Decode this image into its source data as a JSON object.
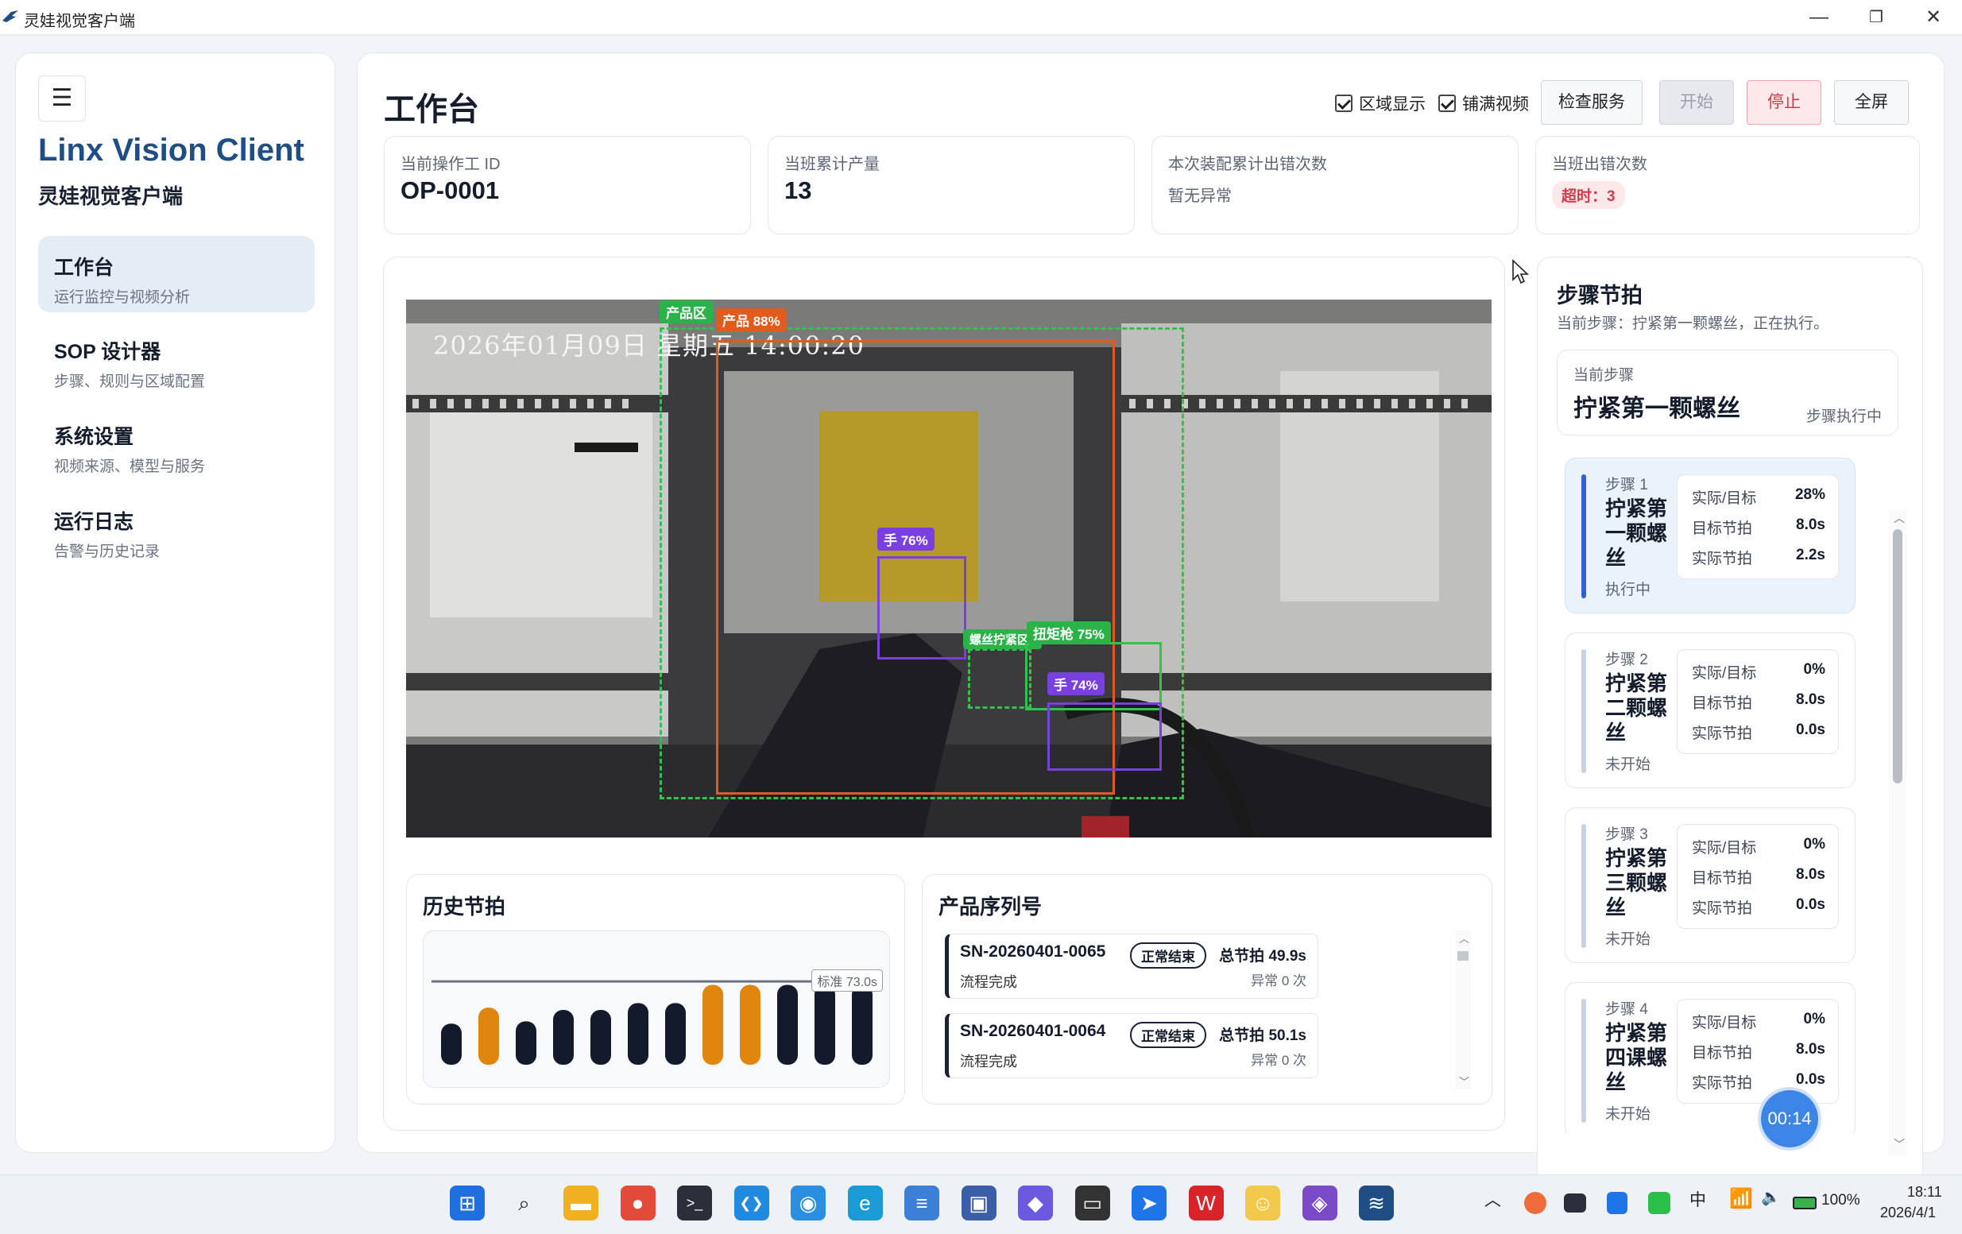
{
  "window": {
    "title": "灵娃视觉客户端",
    "minimize": "—",
    "restore": "❐",
    "close": "✕"
  },
  "sidebar": {
    "menu_icon": "☰",
    "brand": "Linx Vision Client",
    "brand_sub": "灵娃视觉客户端",
    "items": [
      {
        "title": "工作台",
        "desc": "运行监控与视频分析",
        "active": true
      },
      {
        "title": "SOP 设计器",
        "desc": "步骤、规则与区域配置"
      },
      {
        "title": "系统设置",
        "desc": "视频来源、模型与服务"
      },
      {
        "title": "运行日志",
        "desc": "告警与历史记录"
      }
    ]
  },
  "header": {
    "title": "工作台",
    "checkbox_region": "区域显示",
    "checkbox_fill": "铺满视频",
    "btn_check": "检查服务",
    "btn_start": "开始",
    "btn_stop": "停止",
    "btn_full": "全屏"
  },
  "stats": {
    "operator_label": "当前操作工 ID",
    "operator_value": "OP-0001",
    "output_label": "当班累计产量",
    "output_value": "13",
    "errors_label": "本次装配累计出错次数",
    "errors_value": "暂无异常",
    "shift_errors_label": "当班出错次数",
    "shift_errors_badge": "超时：3"
  },
  "video": {
    "osd_time": "2026年01月09日  星期五  14:00:20",
    "detections": [
      {
        "label": "产品区",
        "color": "#2bb34a"
      },
      {
        "label": "产品 88%",
        "color": "#e25a1c"
      },
      {
        "label": "手 76%",
        "color": "#7a3fe0"
      },
      {
        "label": "螺丝拧紧区1",
        "color": "#2bb34a"
      },
      {
        "label": "扭矩枪 75%",
        "color": "#2bb34a"
      },
      {
        "label": "手 74%",
        "color": "#7a3fe0"
      }
    ]
  },
  "history": {
    "title": "历史节拍",
    "standard_label": "标准 73.0s",
    "bar_colors": {
      "normal": "#121a2c",
      "over": "#e0860f"
    }
  },
  "chart_data": {
    "type": "bar",
    "title": "历史节拍",
    "values": [
      36,
      50,
      38,
      48,
      48,
      54,
      54,
      70,
      70,
      70,
      70,
      70
    ],
    "over_standard": [
      false,
      true,
      false,
      false,
      false,
      false,
      false,
      true,
      true,
      false,
      false,
      false
    ],
    "reference_line": {
      "label": "标准 73.0s",
      "value": 73
    }
  },
  "serials": {
    "title": "产品序列号",
    "items": [
      {
        "sn": "SN-20260401-0065",
        "status": "正常结束",
        "total": "总节拍 49.9s",
        "state": "流程完成",
        "errors": "异常 0 次"
      },
      {
        "sn": "SN-20260401-0064",
        "status": "正常结束",
        "total": "总节拍 50.1s",
        "state": "流程完成",
        "errors": "异常 0 次"
      }
    ]
  },
  "steps": {
    "title": "步骤节拍",
    "current_text": "当前步骤：拧紧第一颗螺丝，正在执行。",
    "current_label": "当前步骤",
    "current_name": "拧紧第一颗螺丝",
    "current_state": "步骤执行中",
    "metric_labels": {
      "ratio": "实际/目标",
      "target": "目标节拍",
      "actual": "实际节拍"
    },
    "items": [
      {
        "label": "步骤 1",
        "name": "拧紧第一颗螺丝",
        "state": "执行中",
        "ratio": "28%",
        "target": "8.0s",
        "actual": "2.2s",
        "active": true
      },
      {
        "label": "步骤 2",
        "name": "拧紧第二颗螺丝",
        "state": "未开始",
        "ratio": "0%",
        "target": "8.0s",
        "actual": "0.0s"
      },
      {
        "label": "步骤 3",
        "name": "拧紧第三颗螺丝",
        "state": "未开始",
        "ratio": "0%",
        "target": "8.0s",
        "actual": "0.0s"
      },
      {
        "label": "步骤 4",
        "name": "拧紧第四课螺丝",
        "state": "未开始",
        "ratio": "0%",
        "target": "8.0s",
        "actual": "0.0s"
      }
    ],
    "timer": "00:14"
  },
  "taskbar": {
    "icons": [
      "start-icon",
      "search-icon",
      "folder-icon",
      "chrome-icon",
      "terminal-icon",
      "vscode-icon",
      "docker-icon",
      "edge-icon",
      "notepad-icon",
      "remote-desktop-icon",
      "chat-icon",
      "window-icon",
      "arrow-app-icon",
      "wps-icon",
      "game-icon",
      "visual-studio-icon",
      "linx-vision-icon"
    ],
    "input_method": "中",
    "battery": "100%",
    "time": "18:11",
    "date": "2026/4/1"
  }
}
